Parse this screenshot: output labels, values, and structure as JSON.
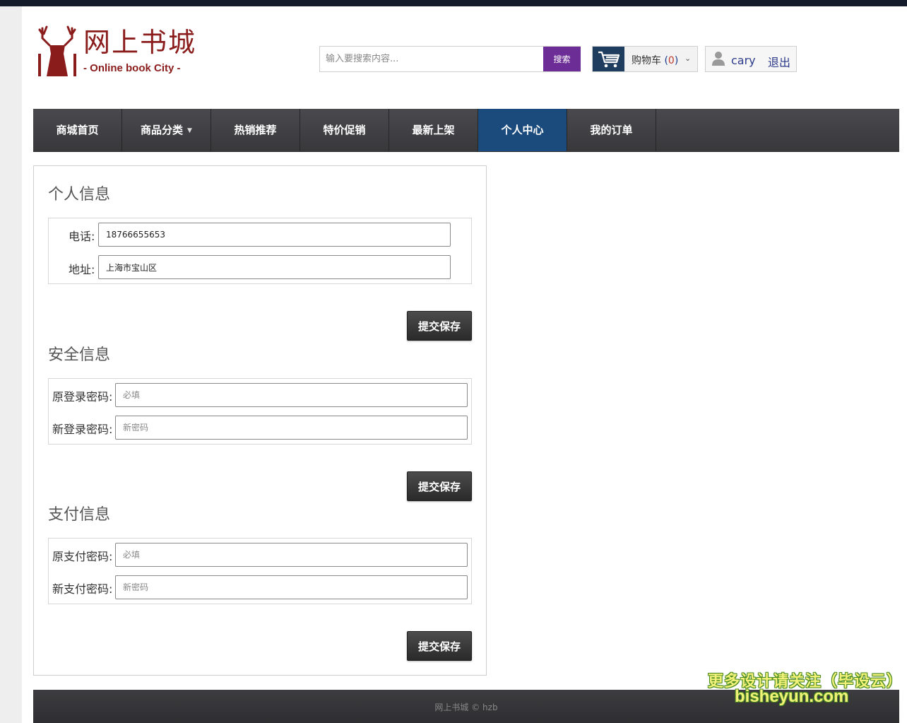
{
  "header": {
    "logo_cn": "网上书城",
    "logo_en": "- Online book City -",
    "search_placeholder": "输入要搜索内容...",
    "search_button": "搜索",
    "cart_label": "购物车",
    "cart_count": "0",
    "username": "cary",
    "logout": "退出"
  },
  "nav": {
    "items": [
      {
        "label": "商城首页"
      },
      {
        "label": "商品分类"
      },
      {
        "label": "热销推荐"
      },
      {
        "label": "特价促销"
      },
      {
        "label": "最新上架"
      },
      {
        "label": "个人中心"
      },
      {
        "label": "我的订单"
      }
    ],
    "active_index": 5
  },
  "profile": {
    "personal": {
      "title": "个人信息",
      "phone_label": "电话:",
      "phone_value": "18766655653",
      "address_label": "地址:",
      "address_value": "上海市宝山区",
      "save": "提交保存"
    },
    "security": {
      "title": "安全信息",
      "old_label": "原登录密码:",
      "old_placeholder": "必填",
      "new_label": "新登录密码:",
      "new_placeholder": "新密码",
      "save": "提交保存"
    },
    "payment": {
      "title": "支付信息",
      "old_label": "原支付密码:",
      "old_placeholder": "必填",
      "new_label": "新支付密码:",
      "new_placeholder": "新密码",
      "save": "提交保存"
    }
  },
  "footer": {
    "text": "网上书城 © hzb"
  },
  "watermark": {
    "line1": "更多设计请关注（毕设云）",
    "line2": "bisheyun.com"
  },
  "colors": {
    "nav_active": "#1b4a7c",
    "search_button": "#6c2d96",
    "logo": "#8b1c1c"
  }
}
